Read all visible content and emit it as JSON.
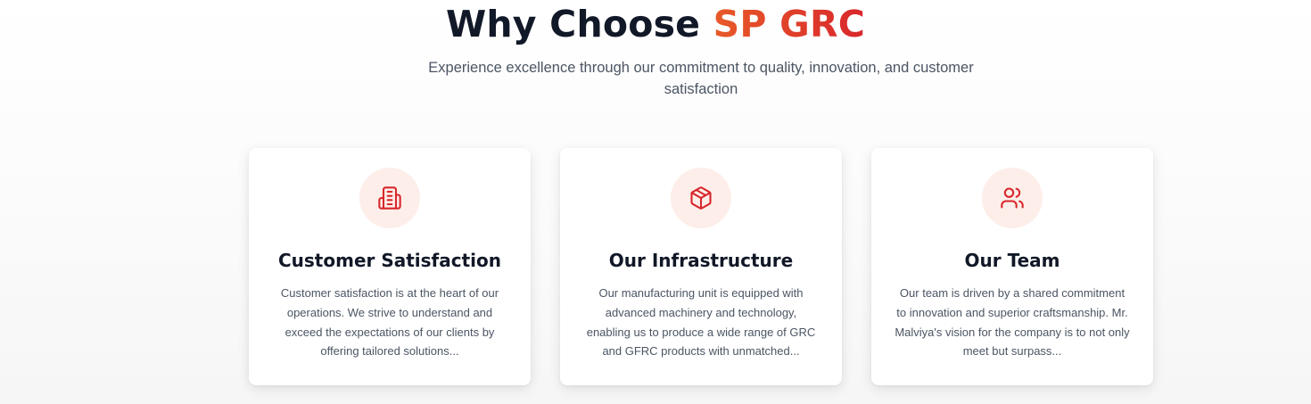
{
  "header": {
    "title_main": "Why Choose ",
    "title_accent": "SP GRC",
    "subtitle": "Experience excellence through our commitment to quality, innovation, and customer satisfaction"
  },
  "colors": {
    "accent_start": "#e85a28",
    "accent_end": "#d8272c",
    "icon_bg": "#fdeee9",
    "icon_stroke": "#d8272c"
  },
  "cards": [
    {
      "icon": "building-icon",
      "title": "Customer Satisfaction",
      "text": "Customer satisfaction is at the heart of our operations. We strive to understand and exceed the expectations of our clients by offering tailored solutions..."
    },
    {
      "icon": "package-icon",
      "title": "Our Infrastructure",
      "text": "Our manufacturing unit is equipped with advanced machinery and technology, enabling us to produce a wide range of GRC and GFRC products with unmatched..."
    },
    {
      "icon": "users-icon",
      "title": "Our Team",
      "text": "Our team is driven by a shared commitment to innovation and superior craftsmanship. Mr. Malviya's vision for the company is to not only meet but surpass..."
    }
  ]
}
